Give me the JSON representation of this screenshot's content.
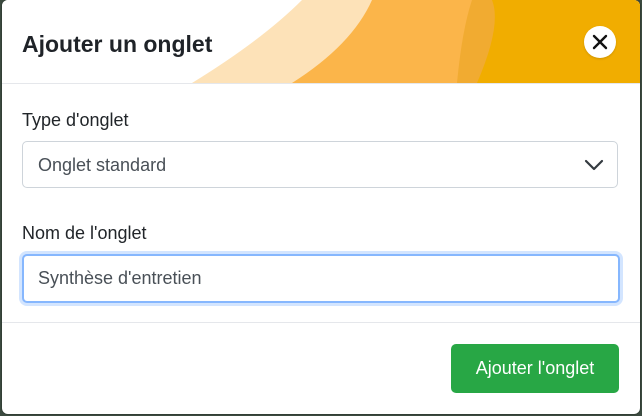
{
  "modal": {
    "title": "Ajouter un onglet",
    "close_icon": "close-icon"
  },
  "form": {
    "type_label": "Type d'onglet",
    "type_selected": "Onglet standard",
    "name_label": "Nom de l'onglet",
    "name_value": "Synthèse d'entretien"
  },
  "footer": {
    "submit_label": "Ajouter l'onglet"
  },
  "colors": {
    "primary_button": "#28a745",
    "focus_border": "#86b7fe",
    "header_accent_light": "#fde2b8",
    "header_accent_mid": "#fbb54a",
    "header_accent_dark": "#f1ad00"
  }
}
